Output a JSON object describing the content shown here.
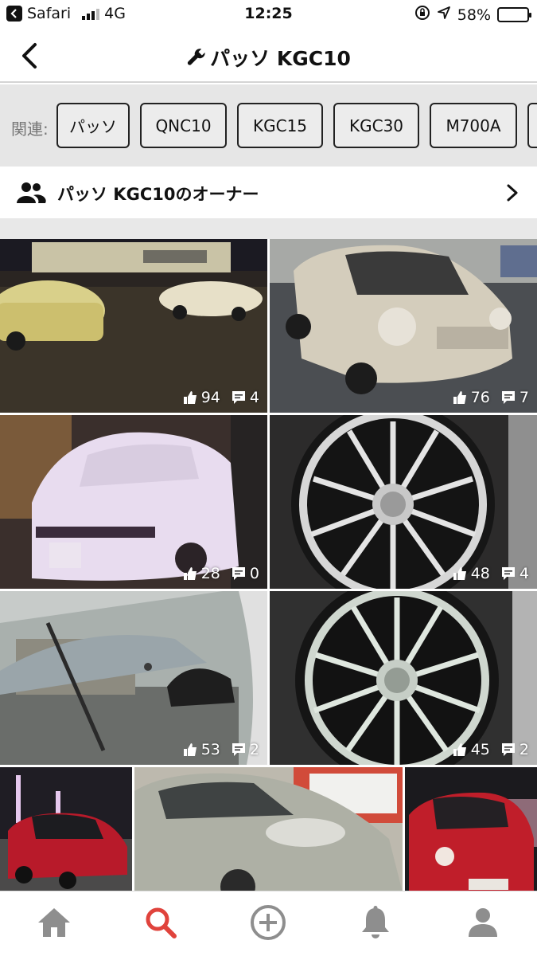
{
  "status_bar": {
    "app": "Safari",
    "network": "4G",
    "time": "12:25",
    "battery": "58%",
    "battery_level": 0.58
  },
  "nav": {
    "title": "パッソ KGC10",
    "wrench_icon": "wrench-icon",
    "back_icon": "chevron-left-icon"
  },
  "related": {
    "label": "関連:",
    "chips": [
      "パッソ",
      "QNC10",
      "KGC15",
      "KGC30",
      "M700A",
      ""
    ]
  },
  "owners": {
    "label": "パッソ KGC10のオーナー",
    "icon": "people-icon"
  },
  "photos": [
    {
      "likes": "94",
      "comments": "4"
    },
    {
      "likes": "76",
      "comments": "7"
    },
    {
      "likes": "28",
      "comments": "0"
    },
    {
      "likes": "48",
      "comments": "4"
    },
    {
      "likes": "53",
      "comments": "2"
    },
    {
      "likes": "45",
      "comments": "2"
    }
  ],
  "tabs": [
    "home-icon",
    "search-icon",
    "add-circle-icon",
    "bell-icon",
    "profile-icon"
  ],
  "colors": {
    "accent": "#e0433c",
    "tab_inactive": "#8e8e8e",
    "chip_bg": "#ececec",
    "related_bg": "#e6e6e6"
  }
}
